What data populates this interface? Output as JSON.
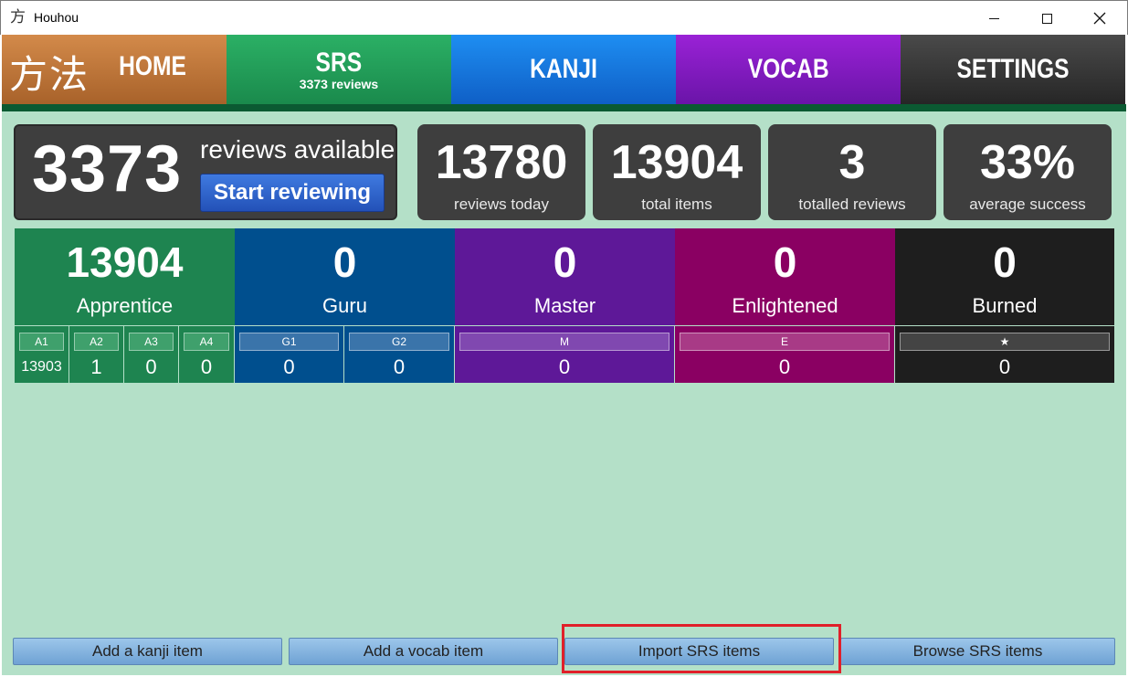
{
  "window": {
    "icon_glyph": "方",
    "title": "Houhou",
    "controls": [
      "minimize",
      "maximize",
      "close"
    ]
  },
  "nav": {
    "logo": "方法",
    "home": "HOME",
    "srs": "SRS",
    "srs_sub": "3373 reviews",
    "kanji": "KANJI",
    "vocab": "VOCAB",
    "settings": "SETTINGS"
  },
  "reviews": {
    "count": "3373",
    "label": "reviews available",
    "start_button": "Start reviewing"
  },
  "stats": [
    {
      "value": "13780",
      "label": "reviews today"
    },
    {
      "value": "13904",
      "label": "total items"
    },
    {
      "value": "3",
      "label": "totalled reviews"
    },
    {
      "value": "33%",
      "label": "average success"
    }
  ],
  "levels": [
    {
      "count": "13904",
      "name": "Apprentice",
      "color": "#1e8450"
    },
    {
      "count": "0",
      "name": "Guru",
      "color": "#004f8e"
    },
    {
      "count": "0",
      "name": "Master",
      "color": "#5e1898"
    },
    {
      "count": "0",
      "name": "Enlightened",
      "color": "#8a0062"
    },
    {
      "count": "0",
      "name": "Burned",
      "color": "#1e1e1e"
    }
  ],
  "sublevels": [
    {
      "tag": "A1",
      "value": "13903"
    },
    {
      "tag": "A2",
      "value": "1"
    },
    {
      "tag": "A3",
      "value": "0"
    },
    {
      "tag": "A4",
      "value": "0"
    },
    {
      "tag": "G1",
      "value": "0"
    },
    {
      "tag": "G2",
      "value": "0"
    },
    {
      "tag": "M",
      "value": "0"
    },
    {
      "tag": "E",
      "value": "0"
    },
    {
      "tag": "★",
      "value": "0"
    }
  ],
  "buttons": {
    "add_kanji": "Add a kanji item",
    "add_vocab": "Add a vocab item",
    "import": "Import SRS items",
    "browse": "Browse SRS items"
  },
  "colors": {
    "background": "#b4e0c8",
    "highlight": "#e0202a",
    "button": "#7fb0dc"
  }
}
